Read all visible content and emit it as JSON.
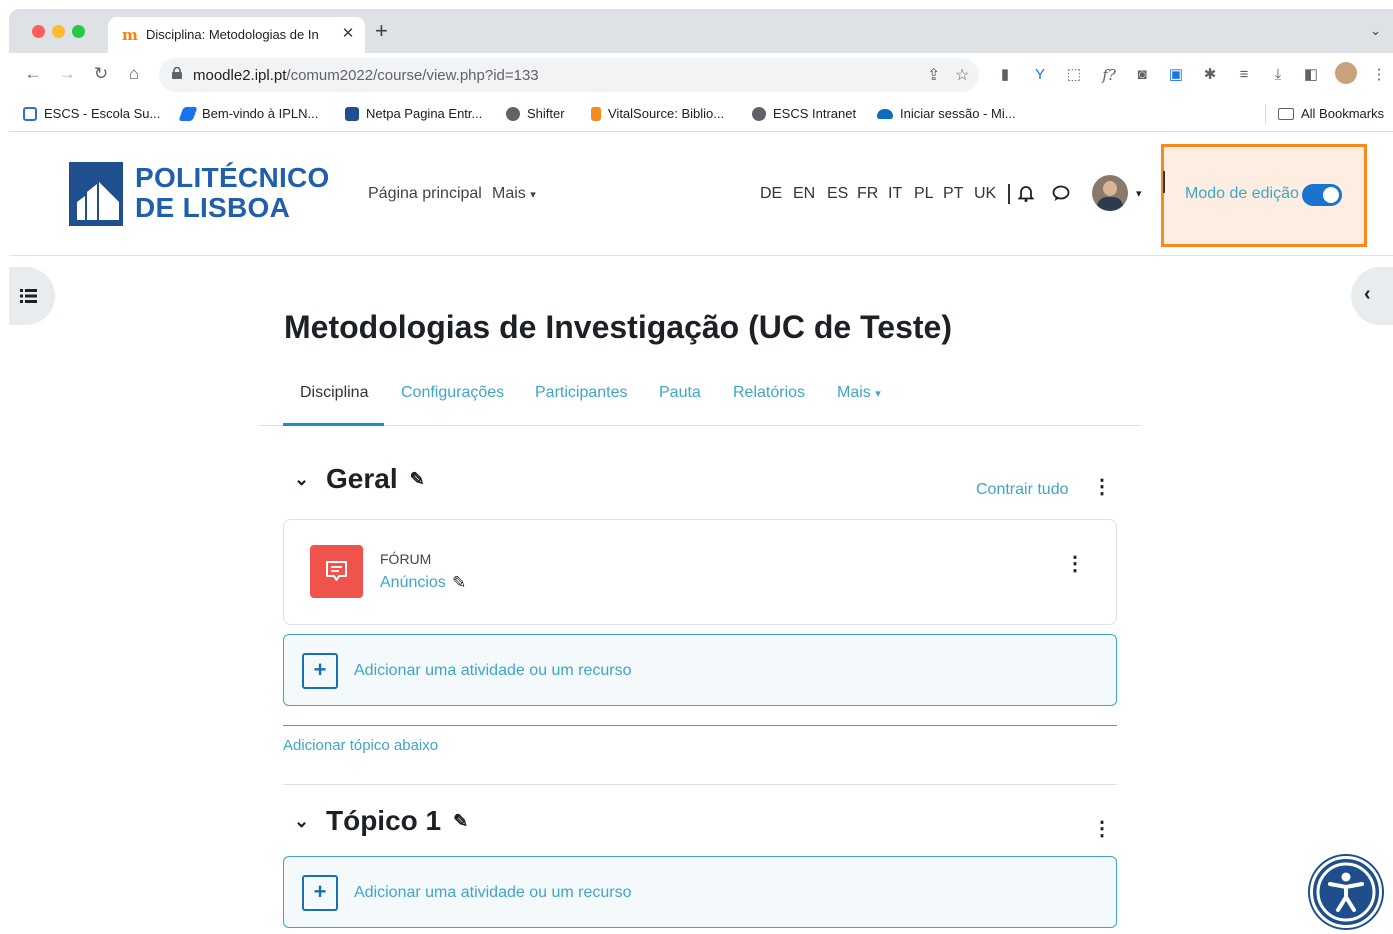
{
  "browser": {
    "tab_title": "Disciplina: Metodologias de In",
    "tab_favicon": "m",
    "new_tab_label": "+",
    "url_domain": "moodle2.ipl.pt",
    "url_path": "/comum2022/course/view.php?id=133",
    "bookmarks": [
      {
        "label": "ESCS - Escola Su...",
        "color": "#2b6fd6"
      },
      {
        "label": "Bem-vindo à IPLN...",
        "color": "#1a73e8"
      },
      {
        "label": "Netpa Pagina Entr...",
        "color": "#1f4f8f"
      },
      {
        "label": "Shifter",
        "color": "#5f6368"
      },
      {
        "label": "VitalSource: Biblio...",
        "color": "#f28c1e"
      },
      {
        "label": "ESCS Intranet",
        "color": "#5f6368"
      },
      {
        "label": "Iniciar sessão - Mi...",
        "color": "#0f6cbd"
      }
    ],
    "all_bookmarks": "All Bookmarks"
  },
  "header": {
    "logo_line1": "POLITÉCNICO",
    "logo_line2": "DE LISBOA",
    "nav": [
      "Página principal",
      "Mais"
    ],
    "languages": [
      "DE",
      "EN",
      "ES",
      "FR",
      "IT",
      "PL",
      "PT",
      "UK"
    ],
    "edit_mode_label": "Modo de edição",
    "edit_mode_on": true
  },
  "course": {
    "title": "Metodologias de Investigação (UC de Teste)",
    "tabs": [
      "Disciplina",
      "Configurações",
      "Participantes",
      "Pauta",
      "Relatórios",
      "Mais"
    ],
    "active_tab": "Disciplina",
    "collapse_all": "Contrair tudo"
  },
  "sections": {
    "general": {
      "title": "Geral",
      "activity_type": "FÓRUM",
      "activity_name": "Anúncios",
      "add_activity": "Adicionar uma atividade ou um recurso",
      "add_topic": "Adicionar tópico abaixo"
    },
    "topic1": {
      "title": "Tópico 1",
      "add_activity": "Adicionar uma atividade ou um recurso"
    }
  },
  "colors": {
    "link": "#3fa5c9",
    "highlight_border": "#f7891e",
    "highlight_fill": "#fdeee1",
    "toggle": "#1a73d1",
    "forum_icon": "#f0534b",
    "brand": "#1f5fae"
  }
}
